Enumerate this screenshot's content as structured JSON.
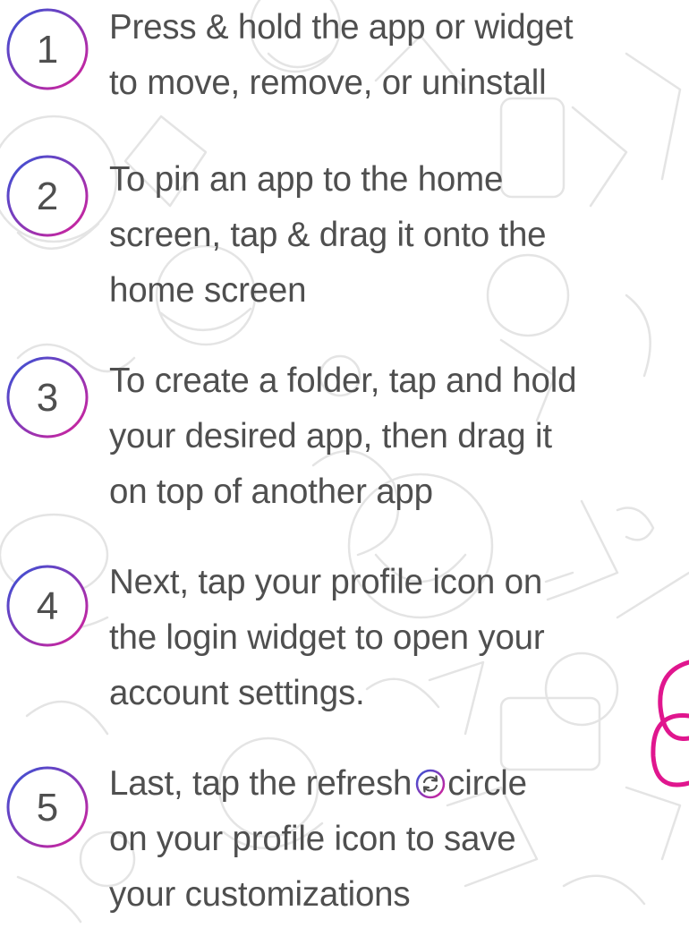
{
  "colors": {
    "text": "#4f4f4f",
    "ring_gradient_start": "#3553d6",
    "ring_gradient_end": "#d7209a",
    "accent_magenta": "#e0168e",
    "doodle": "#e3e3e3"
  },
  "icons": {
    "inline_refresh": "refresh-icon",
    "background": "doodle-pattern"
  },
  "steps": [
    {
      "number": "1",
      "lines": [
        "Press & hold the app or widget",
        "to move, remove, or uninstall"
      ]
    },
    {
      "number": "2",
      "lines": [
        "To pin an app to the home",
        "screen, tap & drag it onto the",
        "home screen"
      ]
    },
    {
      "number": "3",
      "lines": [
        "To create a folder, tap and hold",
        "your desired app, then drag it",
        "on top of another app"
      ]
    },
    {
      "number": "4",
      "lines": [
        "Next, tap your profile icon on",
        "the login widget to open your",
        "account settings."
      ]
    },
    {
      "number": "5",
      "line1_before_icon": "Last, tap the refresh",
      "line1_after_icon": "circle",
      "lines_rest": [
        "on your profile icon to save",
        "your customizations"
      ]
    }
  ]
}
